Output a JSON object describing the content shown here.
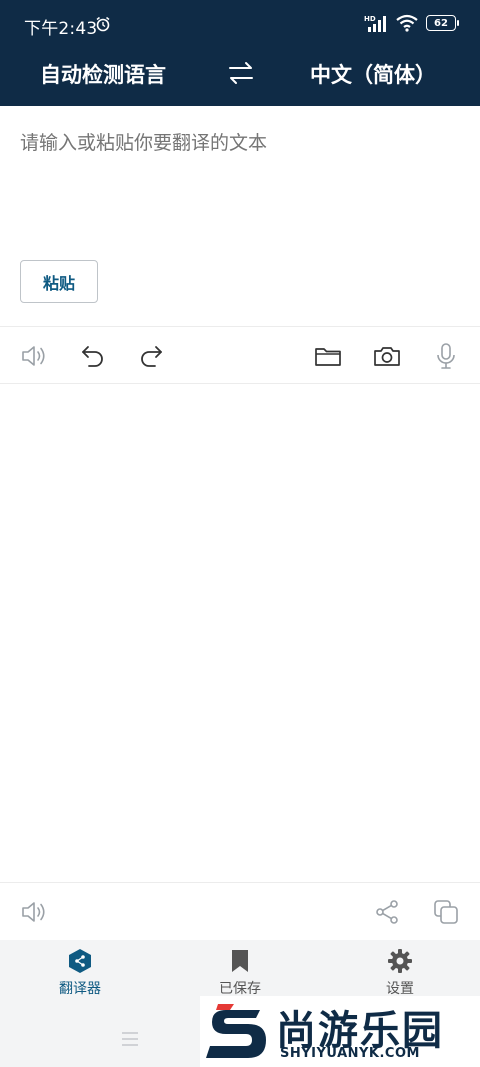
{
  "status": {
    "time": "下午2:43",
    "network": "HD",
    "battery": "62"
  },
  "languages": {
    "source": "自动检测语言",
    "target": "中文（简体）"
  },
  "input": {
    "placeholder": "请输入或粘贴你要翻译的文本",
    "paste_label": "粘贴"
  },
  "input_toolbar": {
    "left": [
      "speaker-icon",
      "undo-icon",
      "redo-icon"
    ],
    "right": [
      "folder-icon",
      "camera-icon",
      "microphone-icon"
    ]
  },
  "output_toolbar": {
    "left": [
      "speaker-icon"
    ],
    "right": [
      "share-icon",
      "copy-icon"
    ]
  },
  "nav": {
    "translator": "翻译器",
    "saved": "已保存",
    "settings": "设置"
  },
  "watermark": {
    "brand_cn": "尚游乐园",
    "brand_en": "SHYIYUANYK.COM"
  },
  "colors": {
    "header": "#0f2b46",
    "accent": "#0f5a82",
    "nav_bg": "#f3f4f5"
  }
}
